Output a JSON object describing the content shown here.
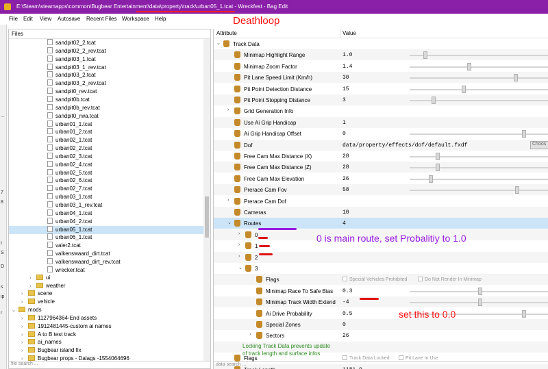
{
  "window": {
    "title": "E:\\Steam\\steamapps\\common\\Bugbear Entertainment\\data\\property\\track\\urban05_1.tcat - Wreckfest - Bag Edit"
  },
  "menu": [
    "File",
    "Edit",
    "View",
    "Autosave",
    "Recent Files",
    "Workspace",
    "Help"
  ],
  "annotations": {
    "deathloop": "Deathloop",
    "main_route": "0 is main route, set Probalitiy to 1.0",
    "set_zero": "set this to 0.0"
  },
  "files": {
    "header": "Files",
    "search_placeholder": "file search ...",
    "rows": [
      {
        "label": "sandpit02_2.tcat",
        "kind": "file",
        "indent": 56
      },
      {
        "label": "sandpit02_2_rev.tcat",
        "kind": "file",
        "indent": 56
      },
      {
        "label": "sandpit03_1.tcat",
        "kind": "file",
        "indent": 56
      },
      {
        "label": "sandpit03_1_rev.tcat",
        "kind": "file",
        "indent": 56
      },
      {
        "label": "sandpit03_2.tcat",
        "kind": "file",
        "indent": 56
      },
      {
        "label": "sandpit03_2_rev.tcat",
        "kind": "file",
        "indent": 56
      },
      {
        "label": "sandpit0_rev.tcat",
        "kind": "file",
        "indent": 56
      },
      {
        "label": "sandpit0b.tcat",
        "kind": "file",
        "indent": 56
      },
      {
        "label": "sandpit0b_rev.tcat",
        "kind": "file",
        "indent": 56
      },
      {
        "label": "sandpit0_rwa.tcat",
        "kind": "file",
        "indent": 56
      },
      {
        "label": "urban01_1.tcat",
        "kind": "file",
        "indent": 56
      },
      {
        "label": "urban01_2.tcat",
        "kind": "file",
        "indent": 56
      },
      {
        "label": "urban02_1.tcat",
        "kind": "file",
        "indent": 56
      },
      {
        "label": "urban02_2.tcat",
        "kind": "file",
        "indent": 56
      },
      {
        "label": "urban02_3.tcat",
        "kind": "file",
        "indent": 56
      },
      {
        "label": "urban02_4.tcat",
        "kind": "file",
        "indent": 56
      },
      {
        "label": "urban02_5.tcat",
        "kind": "file",
        "indent": 56
      },
      {
        "label": "urban02_6.tcat",
        "kind": "file",
        "indent": 56
      },
      {
        "label": "urban02_7.tcat",
        "kind": "file",
        "indent": 56
      },
      {
        "label": "urban03_1.tcat",
        "kind": "file",
        "indent": 56
      },
      {
        "label": "urban03_1_rev.tcat",
        "kind": "file",
        "indent": 56
      },
      {
        "label": "urban04_1.tcat",
        "kind": "file",
        "indent": 56
      },
      {
        "label": "urban04_2.tcat",
        "kind": "file",
        "indent": 56
      },
      {
        "label": "urban05_1.tcat",
        "kind": "file",
        "indent": 56,
        "selected": true
      },
      {
        "label": "urban06_1.tcat",
        "kind": "file",
        "indent": 56
      },
      {
        "label": "valer2.tcat",
        "kind": "file",
        "indent": 56
      },
      {
        "label": "valkenswaard_dirt.tcat",
        "kind": "file",
        "indent": 56
      },
      {
        "label": "valkenswaard_dirt_rev.tcat",
        "kind": "file",
        "indent": 56
      },
      {
        "label": "wrecker.tcat",
        "kind": "file",
        "indent": 56
      },
      {
        "label": "ui",
        "kind": "folder",
        "indent": 30,
        "arrow": "›"
      },
      {
        "label": "weather",
        "kind": "folder",
        "indent": 30,
        "arrow": "›"
      },
      {
        "label": "scene",
        "kind": "folder",
        "indent": 18,
        "arrow": "›"
      },
      {
        "label": "vehicle",
        "kind": "folder",
        "indent": 18,
        "arrow": "›"
      },
      {
        "label": "mods",
        "kind": "folder",
        "indent": 4,
        "arrow": "⌄"
      },
      {
        "label": "1127964364-End assets",
        "kind": "folder",
        "indent": 18,
        "arrow": "›"
      },
      {
        "label": "1912481445-custom ai names",
        "kind": "folder",
        "indent": 18,
        "arrow": "›"
      },
      {
        "label": "A to B test track",
        "kind": "folder",
        "indent": 18,
        "arrow": "›"
      },
      {
        "label": "ai_names",
        "kind": "folder",
        "indent": 18,
        "arrow": "›"
      },
      {
        "label": "Bugbear island fix",
        "kind": "folder",
        "indent": 18,
        "arrow": "›"
      },
      {
        "label": "Bugbear props - Dalags -1554064696",
        "kind": "folder",
        "indent": 18,
        "arrow": "›"
      }
    ]
  },
  "attributes": {
    "col_attribute": "Attribute",
    "col_value": "Value",
    "search_placeholder": "data search ...",
    "choose_label": "Choos",
    "rows": [
      {
        "name": "Track Data",
        "indent": 8,
        "twisty": "⌄",
        "value": ""
      },
      {
        "name": "Minimap Highlight Range",
        "indent": 24,
        "value": "1.0",
        "slider": 0.1
      },
      {
        "name": "Minimap Zoom Factor",
        "indent": 24,
        "value": "1.4",
        "slider": 0.42
      },
      {
        "name": "Pit Lane Speed Limit (Km/h)",
        "indent": 24,
        "value": "30",
        "slider": 0.76
      },
      {
        "name": "Pit Point Detection Distance",
        "indent": 24,
        "value": "15",
        "slider": 0.38
      },
      {
        "name": "Pit Point Stopping Distance",
        "indent": 24,
        "value": "3",
        "slider": 0.16
      },
      {
        "name": "Grid Generation Info",
        "indent": 24,
        "twisty": "›",
        "value": ""
      },
      {
        "name": "Use Ai Grip Handicap",
        "indent": 24,
        "value": "1"
      },
      {
        "name": "Ai Grip Handicap Offset",
        "indent": 24,
        "value": "0",
        "slider": 0.82
      },
      {
        "name": "Dof",
        "indent": 24,
        "value": "data/property/effects/dof/default.fxdf",
        "choose": true
      },
      {
        "name": "Free Cam Max Distance (X)",
        "indent": 24,
        "value": "28",
        "slider": 0.19
      },
      {
        "name": "Free Cam Max Distance (Z)",
        "indent": 24,
        "value": "28",
        "slider": 0.19
      },
      {
        "name": "Free Cam Max Elevation",
        "indent": 24,
        "value": "26",
        "slider": 0.14
      },
      {
        "name": "Prerace Cam Fov",
        "indent": 24,
        "value": "58",
        "slider": 0.77
      },
      {
        "name": "Prerace Cam Dof",
        "indent": 24,
        "twisty": "›",
        "value": ""
      },
      {
        "name": "Cameras",
        "indent": 24,
        "value": "10"
      },
      {
        "name": "Routes",
        "indent": 24,
        "twisty": "⌄",
        "value": "4",
        "selected": true
      },
      {
        "name": "0",
        "indent": 40,
        "twisty": "›",
        "value": ""
      },
      {
        "name": "1",
        "indent": 40,
        "twisty": "›",
        "value": ""
      },
      {
        "name": "2",
        "indent": 40,
        "twisty": "›",
        "value": ""
      },
      {
        "name": "3",
        "indent": 40,
        "twisty": "⌄",
        "value": ""
      },
      {
        "name": "Flags",
        "indent": 56,
        "value": "",
        "checks": [
          "Special Vehicles Prohibited",
          "Do Not Render In Minimap"
        ]
      },
      {
        "name": "Minimap Race To Safe Bias",
        "indent": 56,
        "value": "0.3",
        "slider": 0.5
      },
      {
        "name": "Minimap Track Width Extend",
        "indent": 56,
        "value": "-4",
        "slider": 0.5
      },
      {
        "name": "Ai Drive Probability",
        "indent": 56,
        "value": "0.5",
        "slider": 0.82
      },
      {
        "name": "Special Zones",
        "indent": 56,
        "value": "0"
      },
      {
        "name": "Sectors",
        "indent": 56,
        "twisty": "›",
        "value": "26"
      },
      {
        "name": "",
        "indent": 24,
        "warning": [
          "Locking Track Data prevents update",
          "of track length and surface infos"
        ]
      },
      {
        "name": "Flags",
        "indent": 24,
        "value": "",
        "checks": [
          "Track Data Locked",
          "Pit Lane In Use"
        ]
      },
      {
        "name": "Track Length",
        "indent": 24,
        "value": "1181.9"
      }
    ]
  },
  "left_strip_labels": [
    "...",
    "7",
    "8",
    "t",
    "S",
    "D",
    "s",
    "ip",
    "r"
  ]
}
